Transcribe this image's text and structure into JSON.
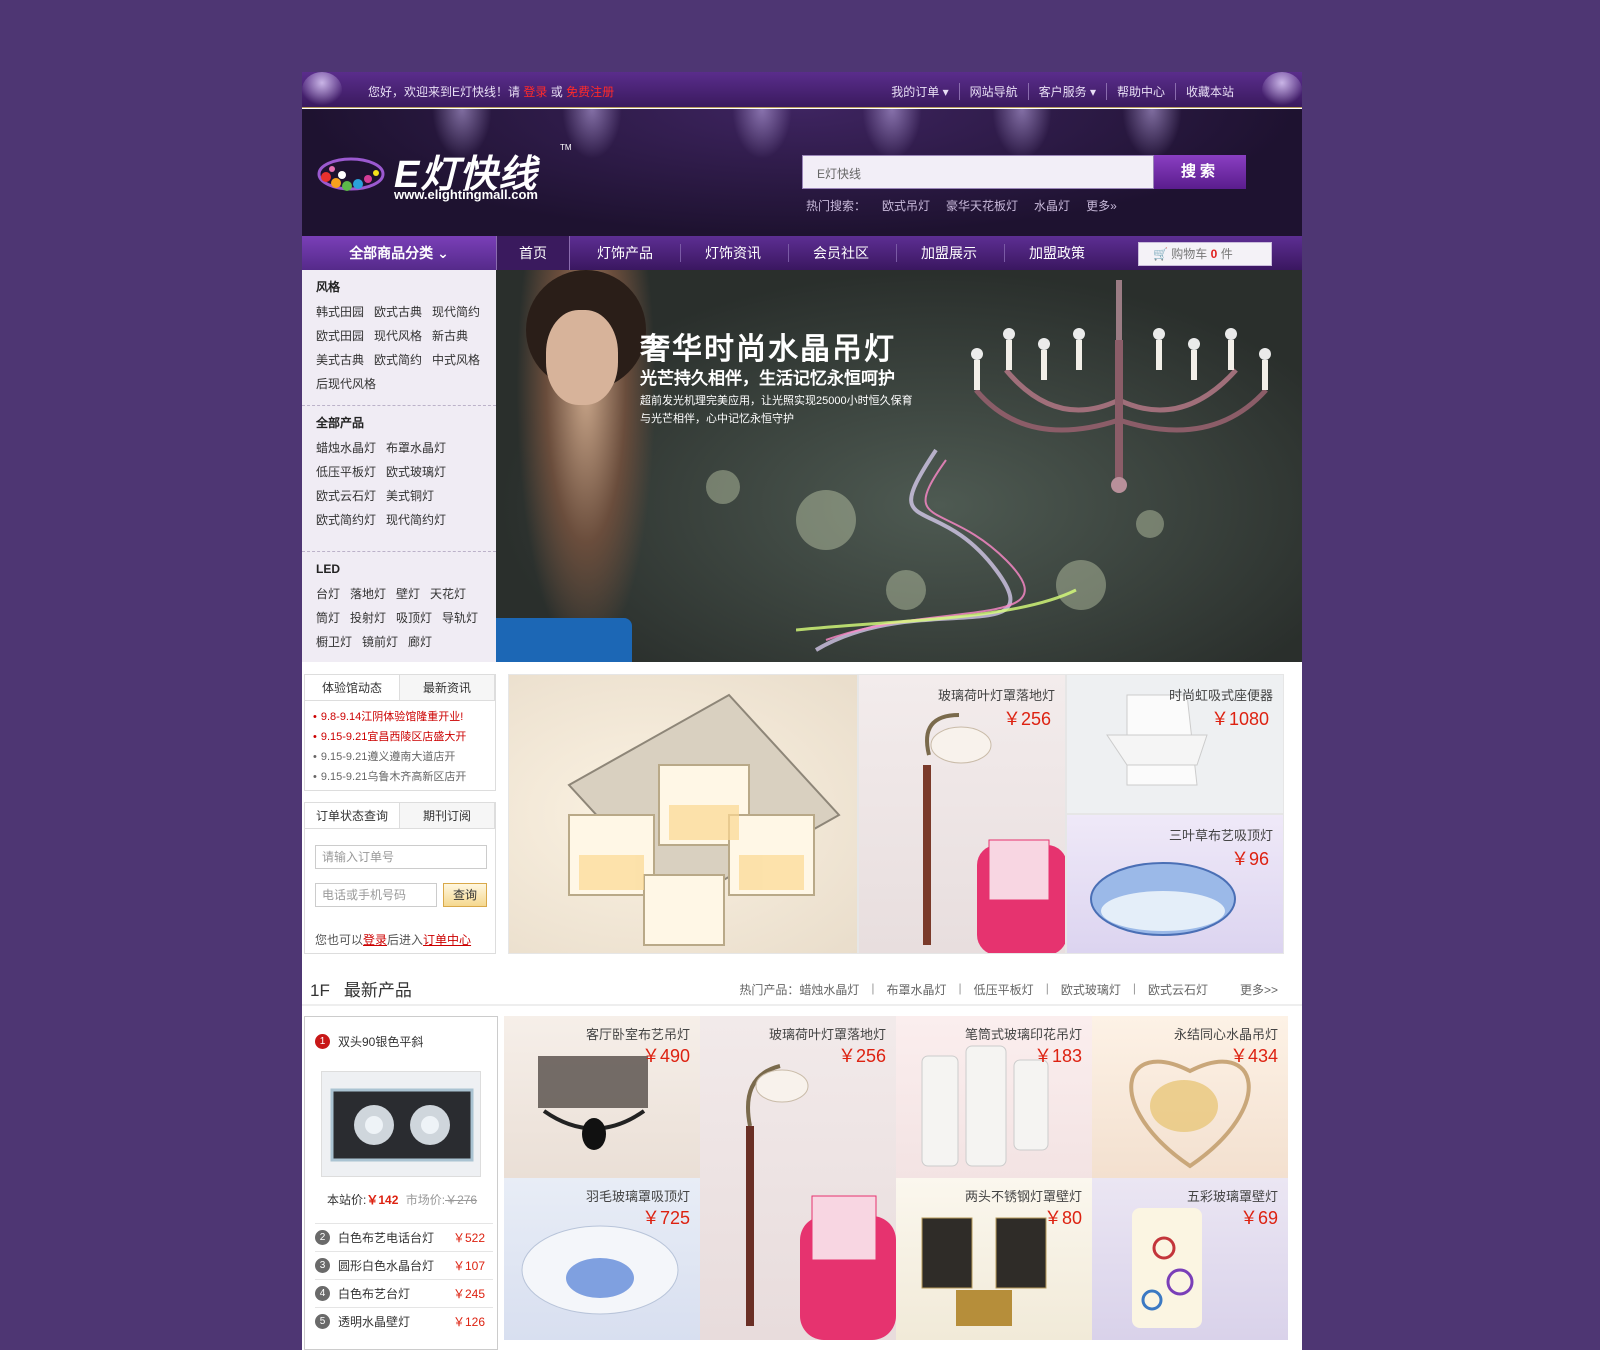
{
  "topbar": {
    "welcome_prefix": "您好，欢迎来到E灯快线！请",
    "login": "登录",
    "or": "或",
    "register": "免费注册",
    "links": [
      "我的订单 ▾",
      "网站导航",
      "客户服务 ▾",
      "帮助中心",
      "收藏本站"
    ]
  },
  "header": {
    "logo_text": "E灯快线",
    "logo_tm": "TM",
    "logo_url": "www.elightingmall.com",
    "search_placeholder": "E灯快线",
    "search_button": "搜索",
    "hot_label": "热门搜索：",
    "hot_terms": [
      "欧式吊灯",
      "豪华天花板灯",
      "水晶灯",
      "更多»"
    ]
  },
  "nav": {
    "all_categories": "全部商品分类",
    "items": [
      "首页",
      "灯饰产品",
      "灯饰资讯",
      "会员社区",
      "加盟展示",
      "加盟政策"
    ],
    "cart_label": "购物车",
    "cart_count": "0",
    "cart_unit": "件"
  },
  "sidebar": {
    "groups": [
      {
        "title": "风格",
        "rows": [
          [
            "韩式田园",
            "欧式古典",
            "现代简约"
          ],
          [
            "欧式田园",
            "现代风格",
            "新古典"
          ],
          [
            "美式古典",
            "欧式简约",
            "中式风格"
          ],
          [
            "后现代风格"
          ]
        ]
      },
      {
        "title": "全部产品",
        "rows": [
          [
            "蜡烛水晶灯",
            "布罩水晶灯"
          ],
          [
            "低压平板灯",
            "欧式玻璃灯"
          ],
          [
            "欧式云石灯",
            "美式铜灯"
          ],
          [
            "欧式简约灯",
            "现代简约灯"
          ]
        ]
      },
      {
        "title": "LED",
        "rows": [
          [
            "台灯",
            "落地灯",
            "壁灯",
            "天花灯"
          ],
          [
            "筒灯",
            "投射灯",
            "吸顶灯",
            "导轨灯"
          ],
          [
            "橱卫灯",
            "镜前灯",
            "廊灯"
          ]
        ]
      }
    ]
  },
  "banner": {
    "title": "奢华时尚水晶吊灯",
    "subtitle": "光芒持久相伴，生活记忆永恒呵护",
    "desc1": "超前发光机理完美应用，让光照实现25000小时恒久保育",
    "desc2": "与光芒相伴，心中记忆永恒守护"
  },
  "news": {
    "tabs": [
      "体验馆动态",
      "最新资讯"
    ],
    "items": [
      "9.8-9.14江阴体验馆隆重开业!",
      "9.15-9.21宜昌西陵区店盛大开",
      "9.15-9.21遵义遵南大道店开",
      "9.15-9.21乌鲁木齐高新区店开"
    ]
  },
  "order": {
    "tabs": [
      "订单状态查询",
      "期刊订阅"
    ],
    "order_placeholder": "请输入订单号",
    "phone_placeholder": "电话或手机号码",
    "query_button": "查询",
    "also_prefix": "您也可以",
    "also_login": "登录",
    "also_middle": "后进入",
    "also_center": "订单中心"
  },
  "promos": [
    {
      "name": "玻璃荷叶灯罩落地灯",
      "price": "￥256"
    },
    {
      "name": "时尚虹吸式座便器",
      "price": "￥1080"
    },
    {
      "name": "三叶草布艺吸顶灯",
      "price": "￥96"
    }
  ],
  "floor": {
    "index": "1F",
    "title": "最新产品",
    "hot_label": "热门产品：",
    "hot_links": [
      "蜡烛水晶灯",
      "布罩水晶灯",
      "低压平板灯",
      "欧式玻璃灯",
      "欧式云石灯"
    ],
    "more": "更多>>"
  },
  "ranking": {
    "first_name": "双头90银色平斜",
    "site_price_label": "本站价:",
    "site_price": "￥142",
    "market_label": "市场价:",
    "market_price": "￥276",
    "items": [
      {
        "num": "2",
        "name": "白色布艺电话台灯",
        "price": "￥522"
      },
      {
        "num": "3",
        "name": "圆形白色水晶台灯",
        "price": "￥107"
      },
      {
        "num": "4",
        "name": "白色布艺台灯",
        "price": "￥245"
      },
      {
        "num": "5",
        "name": "透明水晶壁灯",
        "price": "￥126"
      }
    ]
  },
  "tiles": [
    {
      "name": "客厅卧室布艺吊灯",
      "price": "￥490"
    },
    {
      "name": "玻璃荷叶灯罩落地灯",
      "price": "￥256"
    },
    {
      "name": "笔筒式玻璃印花吊灯",
      "price": "￥183"
    },
    {
      "name": "永结同心水晶吊灯",
      "price": "￥434"
    },
    {
      "name": "羽毛玻璃罩吸顶灯",
      "price": "￥725"
    },
    {
      "name": "两头不锈钢灯罩壁灯",
      "price": "￥80"
    },
    {
      "name": "五彩玻璃罩壁灯",
      "price": "￥69"
    }
  ],
  "colors": {
    "background": "#4e3673",
    "accent": "#5a2d8c",
    "price": "#d21"
  }
}
